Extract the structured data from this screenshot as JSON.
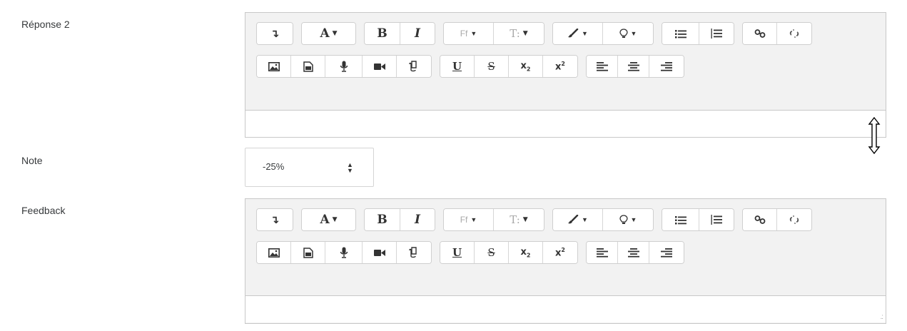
{
  "labels": {
    "answer": "Réponse 2",
    "grade": "Note",
    "feedback": "Feedback"
  },
  "grade_select": {
    "value": "-25%",
    "icon": "sort-arrows-icon"
  },
  "toolbar": {
    "font_color_label": "A",
    "bold_label": "B",
    "italic_label": "I",
    "font_family_label": "Ff",
    "font_size_label": "T:",
    "underline_label": "U",
    "strike_label": "S",
    "subscript_base": "x",
    "subscript_mark": "2",
    "superscript_base": "x",
    "superscript_mark": "2"
  },
  "icons": [
    "show-more-icon",
    "caret-down-icon",
    "brush-icon",
    "lightbulb-icon",
    "bullet-list-icon",
    "numbered-list-icon",
    "link-icon",
    "unlink-icon",
    "image-icon",
    "media-icon",
    "microphone-icon",
    "video-camera-icon",
    "manage-files-icon",
    "align-left-icon",
    "align-center-icon",
    "align-right-icon",
    "resize-cursor-icon",
    "resize-grip-icon"
  ],
  "colors": {
    "editor_bg": "#f2f2f2",
    "border": "#c8c8c8",
    "text": "#373a3c",
    "disabled": "#a9a9a9"
  }
}
